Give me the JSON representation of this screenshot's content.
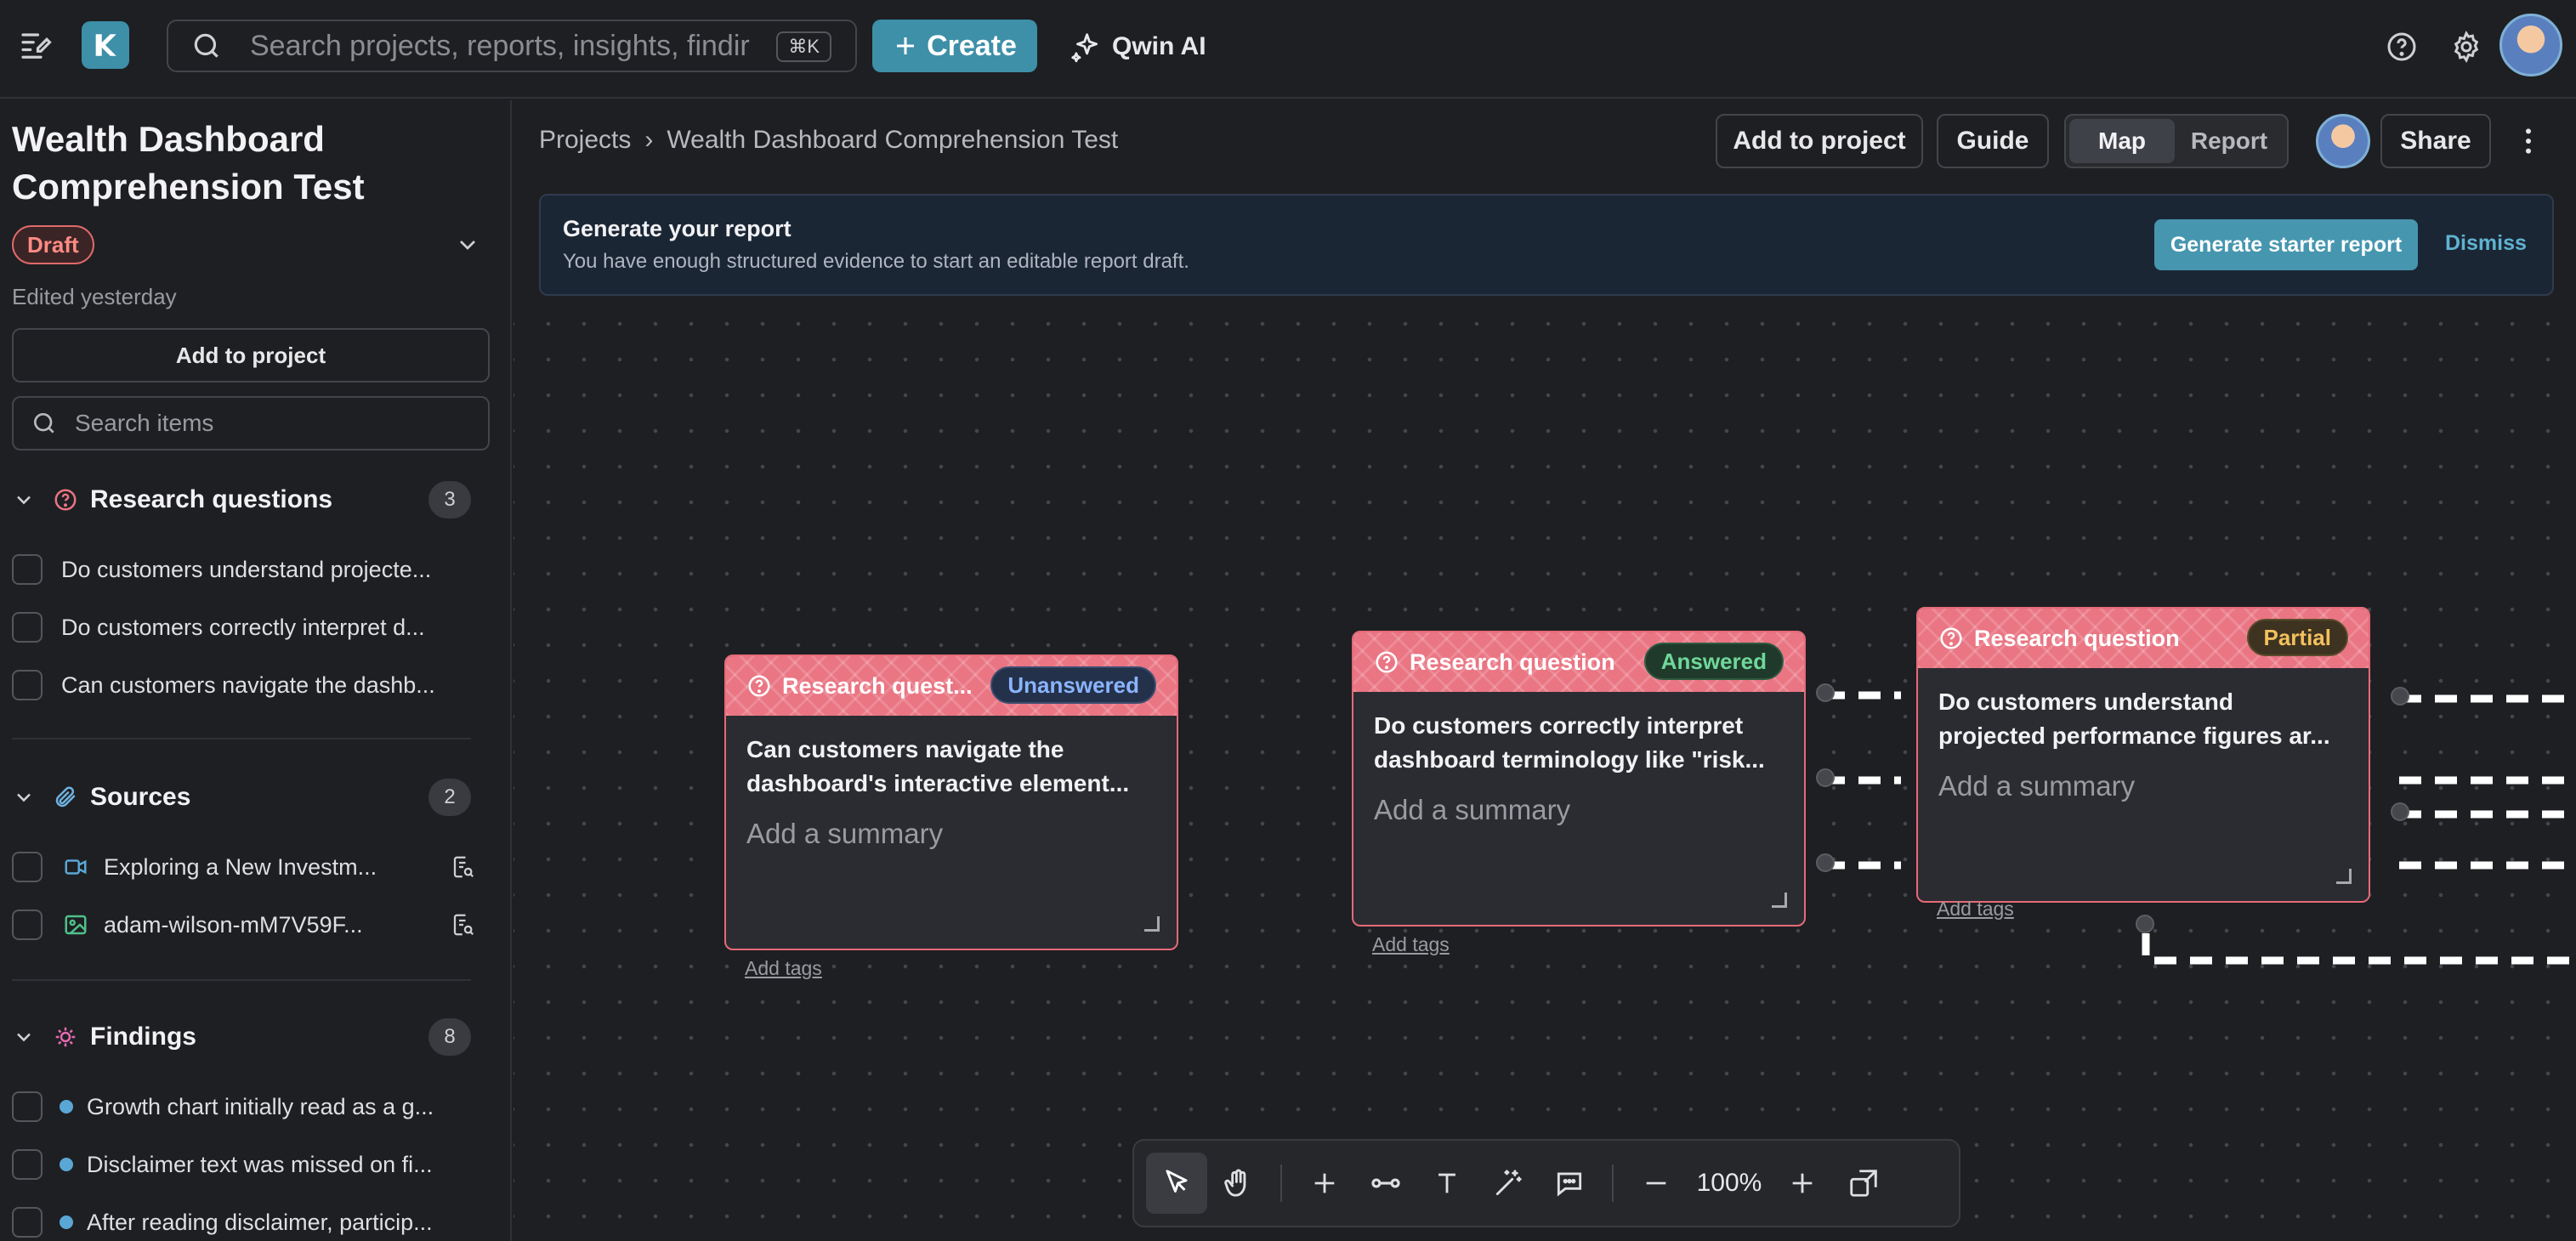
{
  "topbar": {
    "search_placeholder": "Search projects, reports, insights, findir",
    "search_shortcut": "⌘K",
    "create_label": "Create",
    "ai_label": "Qwin AI"
  },
  "sidebar": {
    "project_title": "Wealth Dashboard Comprehension Test",
    "status_badge": "Draft",
    "edited": "Edited yesterday",
    "add_to_project": "Add to project",
    "search_placeholder": "Search items",
    "sections": [
      {
        "title": "Research questions",
        "count": "3",
        "items": [
          "Do customers understand projecte...",
          "Do customers correctly interpret d...",
          "Can customers navigate the dashb..."
        ]
      },
      {
        "title": "Sources",
        "count": "2",
        "items": [
          "Exploring a New Investm...",
          "adam-wilson-mM7V59F..."
        ]
      },
      {
        "title": "Findings",
        "count": "8",
        "items": [
          "Growth chart initially read as a g...",
          "Disclaimer text was missed on fi...",
          "After reading disclaimer, particip..."
        ]
      }
    ]
  },
  "header": {
    "breadcrumb_root": "Projects",
    "breadcrumb_sep": "›",
    "breadcrumb_current": "Wealth Dashboard Comprehension Test",
    "add_to_project": "Add to project",
    "guide": "Guide",
    "view_map": "Map",
    "view_report": "Report",
    "share": "Share"
  },
  "banner": {
    "title": "Generate your report",
    "text": "You have enough structured evidence to start an editable report draft.",
    "generate": "Generate starter report",
    "dismiss": "Dismiss"
  },
  "cards": [
    {
      "type_label": "Research quest...",
      "status": "Unanswered",
      "question": "Can customers navigate the dashboard's interactive element...",
      "summary_placeholder": "Add a summary",
      "add_tags": "Add tags"
    },
    {
      "type_label": "Research question",
      "status": "Answered",
      "question": "Do customers correctly interpret dashboard terminology like \"risk...",
      "summary_placeholder": "Add a summary",
      "add_tags": "Add tags"
    },
    {
      "type_label": "Research question",
      "status": "Partial",
      "question": "Do customers understand projected performance figures ar...",
      "summary_placeholder": "Add a summary",
      "add_tags": "Add tags"
    }
  ],
  "toolbar": {
    "zoom": "100%"
  },
  "colors": {
    "accent": "#3e8fa8",
    "card_header": "#ea7583",
    "unanswered_bg": "#24314a",
    "answered_bg": "#1f3a2a",
    "partial_bg": "#3d3320"
  }
}
